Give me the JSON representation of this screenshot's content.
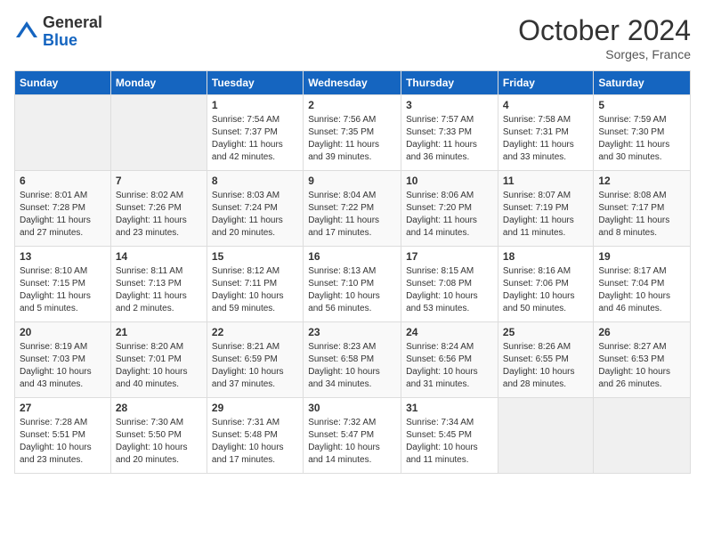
{
  "header": {
    "logo_general": "General",
    "logo_blue": "Blue",
    "month_title": "October 2024",
    "subtitle": "Sorges, France"
  },
  "days_of_week": [
    "Sunday",
    "Monday",
    "Tuesday",
    "Wednesday",
    "Thursday",
    "Friday",
    "Saturday"
  ],
  "weeks": [
    [
      {
        "day": "",
        "empty": true
      },
      {
        "day": "",
        "empty": true
      },
      {
        "day": "1",
        "sunrise": "Sunrise: 7:54 AM",
        "sunset": "Sunset: 7:37 PM",
        "daylight": "Daylight: 11 hours and 42 minutes."
      },
      {
        "day": "2",
        "sunrise": "Sunrise: 7:56 AM",
        "sunset": "Sunset: 7:35 PM",
        "daylight": "Daylight: 11 hours and 39 minutes."
      },
      {
        "day": "3",
        "sunrise": "Sunrise: 7:57 AM",
        "sunset": "Sunset: 7:33 PM",
        "daylight": "Daylight: 11 hours and 36 minutes."
      },
      {
        "day": "4",
        "sunrise": "Sunrise: 7:58 AM",
        "sunset": "Sunset: 7:31 PM",
        "daylight": "Daylight: 11 hours and 33 minutes."
      },
      {
        "day": "5",
        "sunrise": "Sunrise: 7:59 AM",
        "sunset": "Sunset: 7:30 PM",
        "daylight": "Daylight: 11 hours and 30 minutes."
      }
    ],
    [
      {
        "day": "6",
        "sunrise": "Sunrise: 8:01 AM",
        "sunset": "Sunset: 7:28 PM",
        "daylight": "Daylight: 11 hours and 27 minutes."
      },
      {
        "day": "7",
        "sunrise": "Sunrise: 8:02 AM",
        "sunset": "Sunset: 7:26 PM",
        "daylight": "Daylight: 11 hours and 23 minutes."
      },
      {
        "day": "8",
        "sunrise": "Sunrise: 8:03 AM",
        "sunset": "Sunset: 7:24 PM",
        "daylight": "Daylight: 11 hours and 20 minutes."
      },
      {
        "day": "9",
        "sunrise": "Sunrise: 8:04 AM",
        "sunset": "Sunset: 7:22 PM",
        "daylight": "Daylight: 11 hours and 17 minutes."
      },
      {
        "day": "10",
        "sunrise": "Sunrise: 8:06 AM",
        "sunset": "Sunset: 7:20 PM",
        "daylight": "Daylight: 11 hours and 14 minutes."
      },
      {
        "day": "11",
        "sunrise": "Sunrise: 8:07 AM",
        "sunset": "Sunset: 7:19 PM",
        "daylight": "Daylight: 11 hours and 11 minutes."
      },
      {
        "day": "12",
        "sunrise": "Sunrise: 8:08 AM",
        "sunset": "Sunset: 7:17 PM",
        "daylight": "Daylight: 11 hours and 8 minutes."
      }
    ],
    [
      {
        "day": "13",
        "sunrise": "Sunrise: 8:10 AM",
        "sunset": "Sunset: 7:15 PM",
        "daylight": "Daylight: 11 hours and 5 minutes."
      },
      {
        "day": "14",
        "sunrise": "Sunrise: 8:11 AM",
        "sunset": "Sunset: 7:13 PM",
        "daylight": "Daylight: 11 hours and 2 minutes."
      },
      {
        "day": "15",
        "sunrise": "Sunrise: 8:12 AM",
        "sunset": "Sunset: 7:11 PM",
        "daylight": "Daylight: 10 hours and 59 minutes."
      },
      {
        "day": "16",
        "sunrise": "Sunrise: 8:13 AM",
        "sunset": "Sunset: 7:10 PM",
        "daylight": "Daylight: 10 hours and 56 minutes."
      },
      {
        "day": "17",
        "sunrise": "Sunrise: 8:15 AM",
        "sunset": "Sunset: 7:08 PM",
        "daylight": "Daylight: 10 hours and 53 minutes."
      },
      {
        "day": "18",
        "sunrise": "Sunrise: 8:16 AM",
        "sunset": "Sunset: 7:06 PM",
        "daylight": "Daylight: 10 hours and 50 minutes."
      },
      {
        "day": "19",
        "sunrise": "Sunrise: 8:17 AM",
        "sunset": "Sunset: 7:04 PM",
        "daylight": "Daylight: 10 hours and 46 minutes."
      }
    ],
    [
      {
        "day": "20",
        "sunrise": "Sunrise: 8:19 AM",
        "sunset": "Sunset: 7:03 PM",
        "daylight": "Daylight: 10 hours and 43 minutes."
      },
      {
        "day": "21",
        "sunrise": "Sunrise: 8:20 AM",
        "sunset": "Sunset: 7:01 PM",
        "daylight": "Daylight: 10 hours and 40 minutes."
      },
      {
        "day": "22",
        "sunrise": "Sunrise: 8:21 AM",
        "sunset": "Sunset: 6:59 PM",
        "daylight": "Daylight: 10 hours and 37 minutes."
      },
      {
        "day": "23",
        "sunrise": "Sunrise: 8:23 AM",
        "sunset": "Sunset: 6:58 PM",
        "daylight": "Daylight: 10 hours and 34 minutes."
      },
      {
        "day": "24",
        "sunrise": "Sunrise: 8:24 AM",
        "sunset": "Sunset: 6:56 PM",
        "daylight": "Daylight: 10 hours and 31 minutes."
      },
      {
        "day": "25",
        "sunrise": "Sunrise: 8:26 AM",
        "sunset": "Sunset: 6:55 PM",
        "daylight": "Daylight: 10 hours and 28 minutes."
      },
      {
        "day": "26",
        "sunrise": "Sunrise: 8:27 AM",
        "sunset": "Sunset: 6:53 PM",
        "daylight": "Daylight: 10 hours and 26 minutes."
      }
    ],
    [
      {
        "day": "27",
        "sunrise": "Sunrise: 7:28 AM",
        "sunset": "Sunset: 5:51 PM",
        "daylight": "Daylight: 10 hours and 23 minutes."
      },
      {
        "day": "28",
        "sunrise": "Sunrise: 7:30 AM",
        "sunset": "Sunset: 5:50 PM",
        "daylight": "Daylight: 10 hours and 20 minutes."
      },
      {
        "day": "29",
        "sunrise": "Sunrise: 7:31 AM",
        "sunset": "Sunset: 5:48 PM",
        "daylight": "Daylight: 10 hours and 17 minutes."
      },
      {
        "day": "30",
        "sunrise": "Sunrise: 7:32 AM",
        "sunset": "Sunset: 5:47 PM",
        "daylight": "Daylight: 10 hours and 14 minutes."
      },
      {
        "day": "31",
        "sunrise": "Sunrise: 7:34 AM",
        "sunset": "Sunset: 5:45 PM",
        "daylight": "Daylight: 10 hours and 11 minutes."
      },
      {
        "day": "",
        "empty": true
      },
      {
        "day": "",
        "empty": true
      }
    ]
  ]
}
